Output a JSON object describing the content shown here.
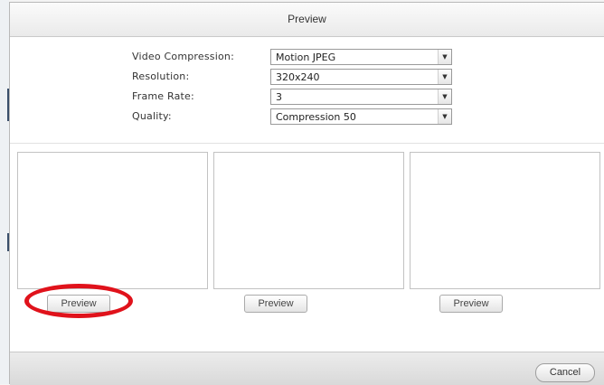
{
  "dialog": {
    "title": "Preview"
  },
  "settings": [
    {
      "label": "Video Compression:",
      "value": "Motion JPEG",
      "arrow": "▼"
    },
    {
      "label": "Resolution:",
      "value": "320x240",
      "arrow": "▼"
    },
    {
      "label": "Frame Rate:",
      "value": "3",
      "arrow": "▼"
    },
    {
      "label": "Quality:",
      "value": "Compression 50",
      "arrow": "▼"
    }
  ],
  "panels": [
    {
      "button_label": "Preview"
    },
    {
      "button_label": "Preview"
    },
    {
      "button_label": "Preview"
    }
  ],
  "footer": {
    "cancel_label": "Cancel"
  },
  "colors": {
    "highlight": "#e0121b",
    "accent_edge": "#3a4f6a"
  }
}
